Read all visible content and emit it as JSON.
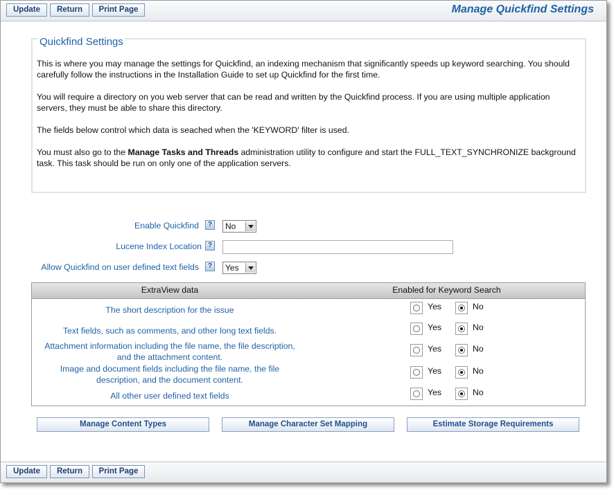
{
  "toolbar": {
    "update_label": "Update",
    "return_label": "Return",
    "print_label": "Print Page",
    "page_title": "Manage Quickfind Settings"
  },
  "info": {
    "title": "Quickfind Settings",
    "p1": "This is where you may manage the settings for Quickfind, an indexing mechanism that significantly speeds up keyword searching. You should carefully follow the instructions in the Installation Guide to set up Quickfind for the first time.",
    "p2": "You will require a directory on you web server that can be read and written by the Quickfind process. If you are using multiple application servers, they must be able to share this directory.",
    "p3": "The fields below control which data is seached when the 'KEYWORD' filter is used.",
    "p4_before": "You must also go to the ",
    "p4_bold": "Manage Tasks and Threads",
    "p4_after": " administration utility to configure and start the FULL_TEXT_SYNCHRONIZE background task. This task should be run on only one of the application servers."
  },
  "form": {
    "enable_label": "Enable Quickfind",
    "enable_value": "No",
    "location_label": "Lucene Index Location",
    "location_value": "",
    "user_defined_label": "Allow Quickfind on user defined text fields",
    "user_defined_value": "Yes",
    "help_glyph": "?"
  },
  "table": {
    "col1": "ExtraView data",
    "col2": "Enabled for Keyword Search",
    "yes_label": "Yes",
    "no_label": "No",
    "rows": [
      {
        "line1": "The short description for the issue",
        "line2": "",
        "enabled": false
      },
      {
        "line1": "Text fields, such as comments, and other long text fields.",
        "line2": "",
        "enabled": false
      },
      {
        "line1": "Attachment information including the file name, the file description,",
        "line2": "and the attachment content.",
        "enabled": false
      },
      {
        "line1": "Image and document fields including the file name, the file",
        "line2": "description, and the document content.",
        "enabled": false
      },
      {
        "line1": "All other user defined text fields",
        "line2": "",
        "enabled": false
      }
    ]
  },
  "buttons": {
    "content_types": "Manage Content Types",
    "charset_mapping": "Manage Character Set Mapping",
    "storage": "Estimate Storage Requirements"
  },
  "colors": {
    "accent": "#1f62a6",
    "button_text": "#1e3f73"
  }
}
